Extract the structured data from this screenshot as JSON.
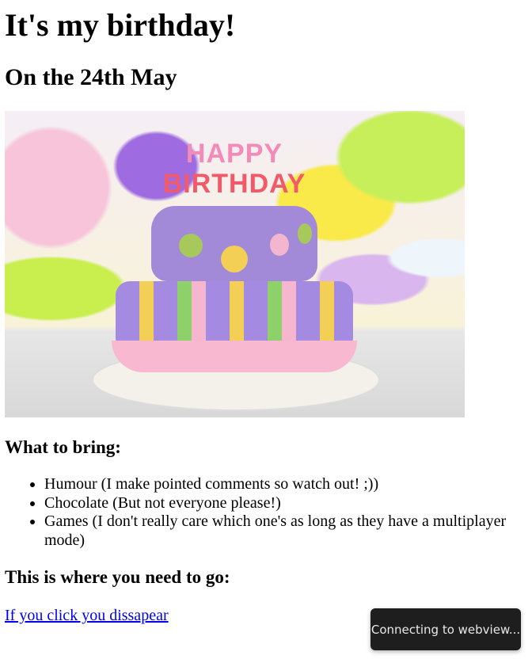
{
  "title": "It's my birthday!",
  "subtitle": "On the 24th May",
  "image": {
    "alt": "Happy Birthday cake",
    "cake_text": [
      "HAPPY",
      "BIRTHDAY"
    ]
  },
  "bring": {
    "heading": "What to bring:",
    "items": [
      "Humour (I make pointed comments so watch out! ;))",
      "Chocolate (But not everyone please!)",
      "Games (I don't really care which one's as long as they have a multiplayer mode)"
    ]
  },
  "location": {
    "heading": "This is where you need to go:",
    "link": "If you click you dissapear"
  },
  "toast": "Connecting to webview..."
}
